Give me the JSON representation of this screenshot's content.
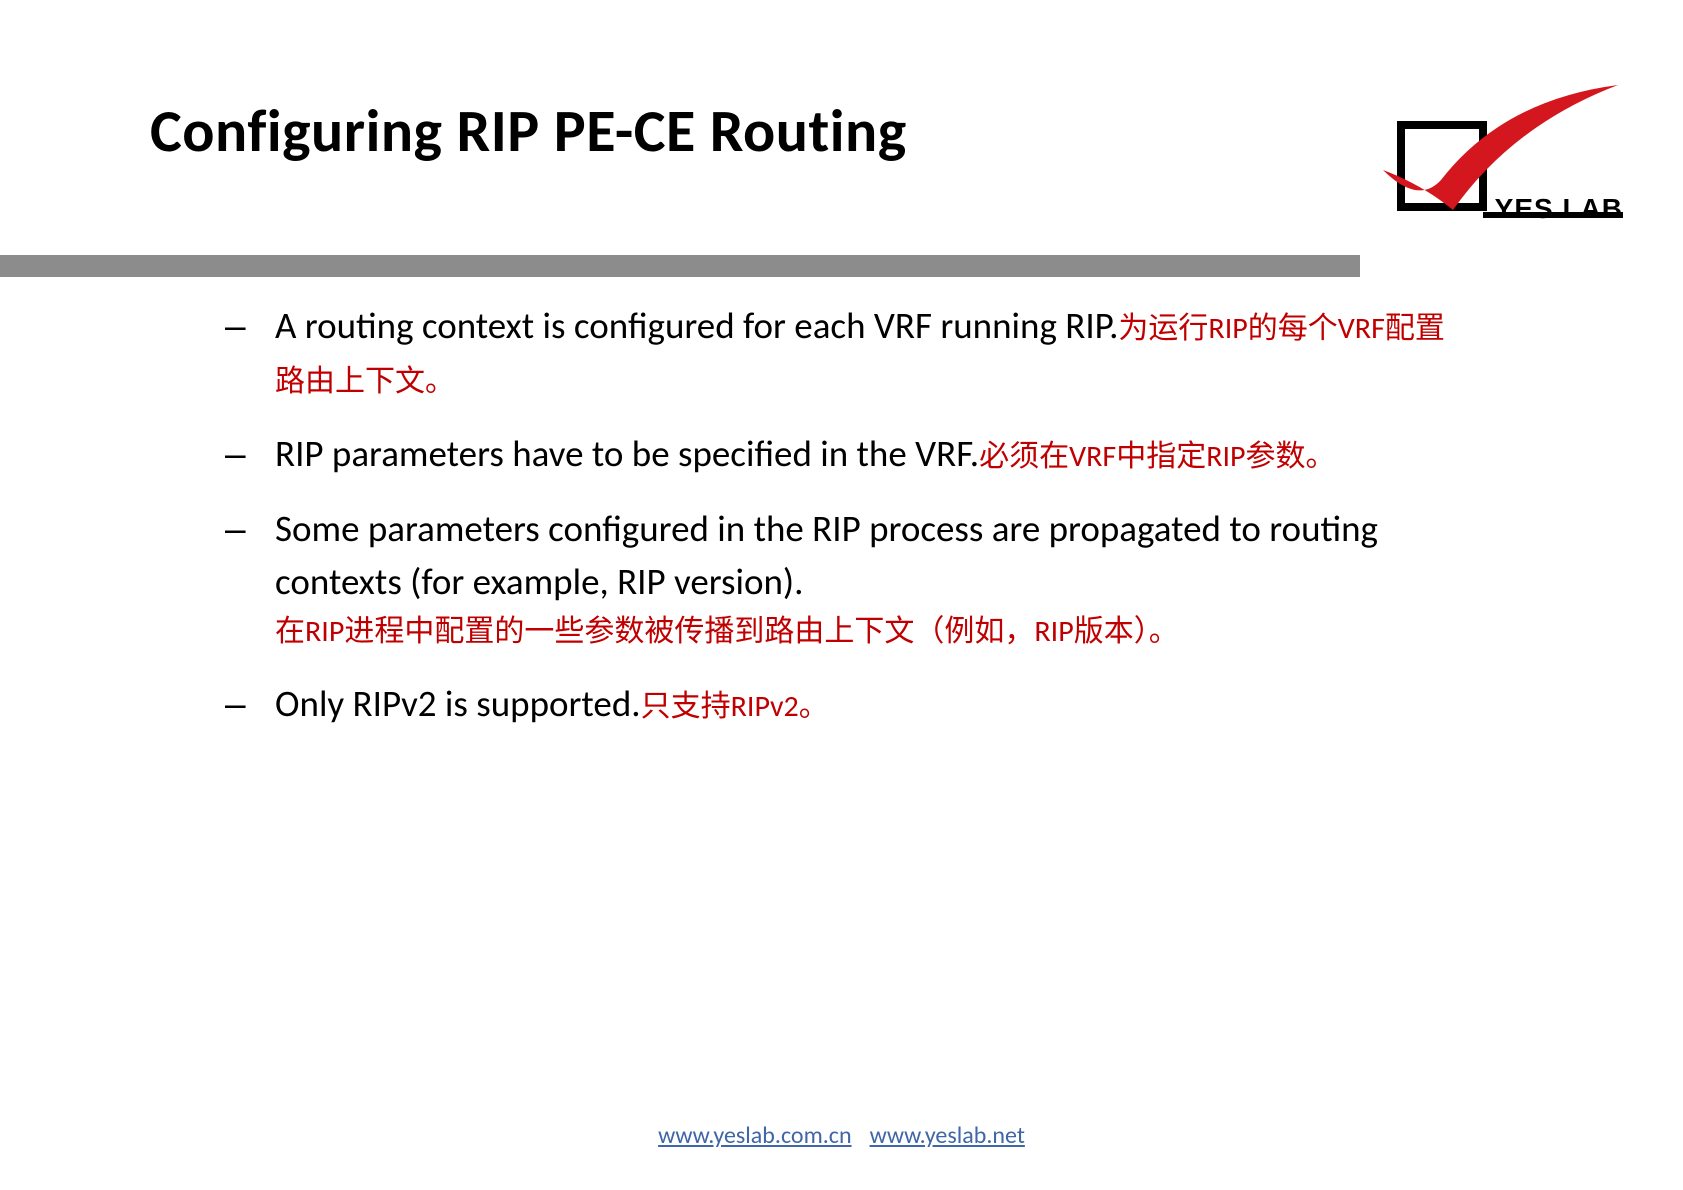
{
  "title": "Configuring RIP PE-CE Routing",
  "logo": {
    "text": "YES LAB"
  },
  "bullets": [
    {
      "en": "A routing context is configured for each VRF running RIP.",
      "zh": "为运行RIP的每个VRF配置路由上下文。",
      "zh_inline": false
    },
    {
      "en": "RIP parameters have to be specified in the VRF.",
      "zh": "必须在VRF中指定RIP参数。",
      "zh_inline": true
    },
    {
      "en": "Some parameters configured in the RIP process are propagated to routing contexts (for example, RIP version).",
      "zh": "在RIP进程中配置的一些参数被传播到路由上下文（例如，RIP版本）。",
      "zh_inline": false,
      "zh_block": true
    },
    {
      "en": "Only RIPv2 is supported.",
      "zh": "只支持RIPv2。",
      "zh_inline": true
    }
  ],
  "footer": {
    "link1": "www.yeslab.com.cn",
    "link2": "www.yeslab.net"
  }
}
